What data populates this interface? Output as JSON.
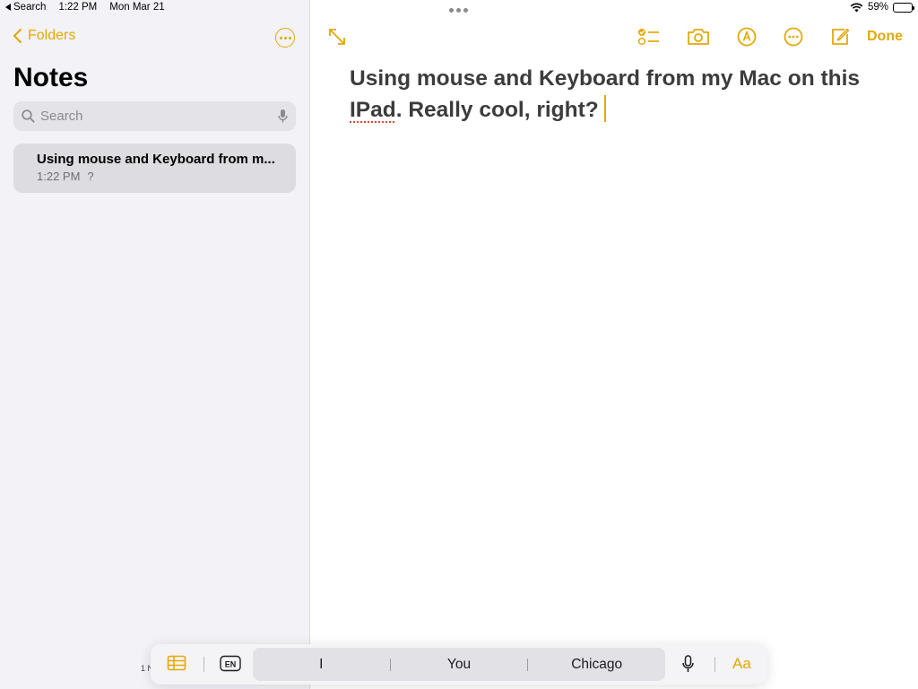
{
  "status_bar": {
    "back_app": "Search",
    "time": "1:22 PM",
    "date": "Mon Mar 21",
    "battery_percent": "59%",
    "battery_level": 0.59
  },
  "sidebar": {
    "back_label": "Folders",
    "title": "Notes",
    "search": {
      "placeholder": "Search",
      "value": ""
    },
    "notes": [
      {
        "title": "Using mouse and Keyboard from m...",
        "time": "1:22 PM",
        "preview": "?"
      }
    ],
    "footer_count": "1 N"
  },
  "toolbar": {
    "done_label": "Done",
    "icons": [
      "expand-icon",
      "checklist-icon",
      "camera-icon",
      "markup-icon",
      "more-icon",
      "compose-icon"
    ]
  },
  "note": {
    "text_before": "Using mouse and Keyboard from my Mac on this ",
    "misspelled_word": "IPad",
    "text_after": ". Really cool, right?"
  },
  "keyboard_bar": {
    "language": "EN",
    "suggestions": [
      "I",
      "You",
      "Chicago"
    ],
    "format_label": "Aa"
  },
  "colors": {
    "accent": "#e2a90a",
    "sidebar_bg": "#f2f2f7",
    "selected_row": "#dcdce1",
    "note_text": "#3c3c3e",
    "spelling_error": "#e0463a"
  }
}
